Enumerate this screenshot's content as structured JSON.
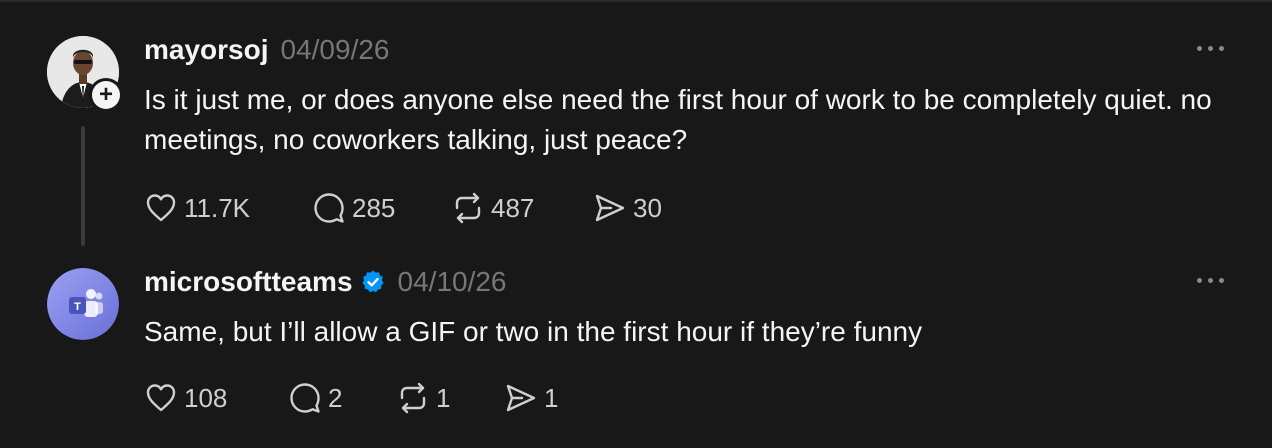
{
  "posts": [
    {
      "username": "mayorsoj",
      "date": "04/09/26",
      "text": "Is it just me, or does anyone else need the first hour of work to be completely quiet. no meetings, no coworkers talking, just peace?",
      "verified": false,
      "likes": "11.7K",
      "replies": "285",
      "reposts": "487",
      "shares": "30"
    },
    {
      "username": "microsoftteams",
      "date": "04/10/26",
      "text": "Same, but I’ll allow a GIF or two in the first hour if they’re funny",
      "verified": true,
      "likes": "108",
      "replies": "2",
      "reposts": "1",
      "shares": "1"
    }
  ],
  "icons": {
    "like": "heart-icon",
    "reply": "speech-bubble-icon",
    "repost": "repost-arrows-icon",
    "share": "send-icon",
    "more": "more-horizontal-icon",
    "verified": "verified-badge-icon",
    "follow": "plus-icon"
  },
  "colors": {
    "background": "#181818",
    "text": "#f3f5f7",
    "muted": "#777777",
    "verified": "#0095f6",
    "teams_purple": "#7b83eb"
  }
}
